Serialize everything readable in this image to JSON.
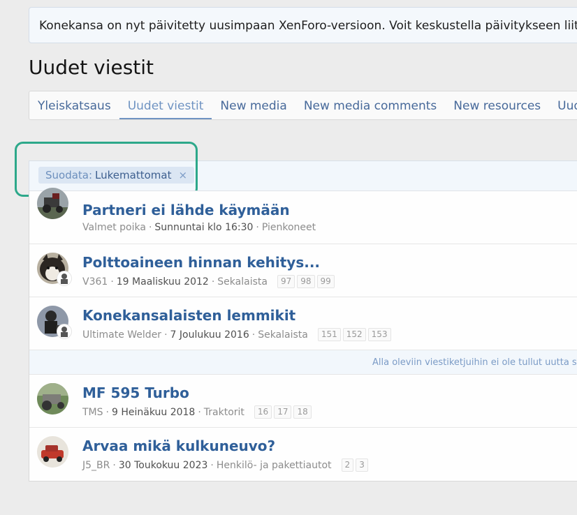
{
  "notice": {
    "text": "Konekansa on nyt päivitetty uusimpaan XenForo-versioon. Voit keskustella päivitykseen liittyvi"
  },
  "page": {
    "title": "Uudet viestit"
  },
  "tabs": [
    {
      "label": "Yleiskatsaus"
    },
    {
      "label": "Uudet viestit"
    },
    {
      "label": "New media"
    },
    {
      "label": "New media comments"
    },
    {
      "label": "New resources"
    },
    {
      "label": "Uude"
    }
  ],
  "filter": {
    "prefix": "Suodata:",
    "value": "Lukemattomat",
    "remove_symbol": "×"
  },
  "threads": [
    {
      "title": "Partneri ei lähde käymään",
      "author": "Valmet poika",
      "date": "Sunnuntai klo 16:30",
      "forum": "Pienkoneet",
      "pages": []
    },
    {
      "title": "Polttoaineen hinnan kehitys...",
      "author": "V361",
      "date": "19 Maaliskuu 2012",
      "forum": "Sekalaista",
      "pages": [
        "97",
        "98",
        "99"
      ]
    },
    {
      "title": "Konekansalaisten lemmikit",
      "author": "Ultimate Welder",
      "date": "7 Joulukuu 2016",
      "forum": "Sekalaista",
      "pages": [
        "151",
        "152",
        "153"
      ]
    },
    {
      "title": "MF 595 Turbo",
      "author": "TMS",
      "date": "9 Heinäkuu 2018",
      "forum": "Traktorit",
      "pages": [
        "16",
        "17",
        "18"
      ]
    },
    {
      "title": "Arvaa mikä kulkuneuvo?",
      "author": "J5_BR",
      "date": "30 Toukokuu 2023",
      "forum": "Henkilö- ja pakettiautot",
      "pages": [
        "2",
        "3"
      ]
    }
  ],
  "divider": {
    "text": "Alla oleviin viestiketjuihin ei ole tullut uutta s"
  },
  "colors": {
    "link": "#2f5f99",
    "tab": "#47699a",
    "highlight": "#2da88a"
  }
}
